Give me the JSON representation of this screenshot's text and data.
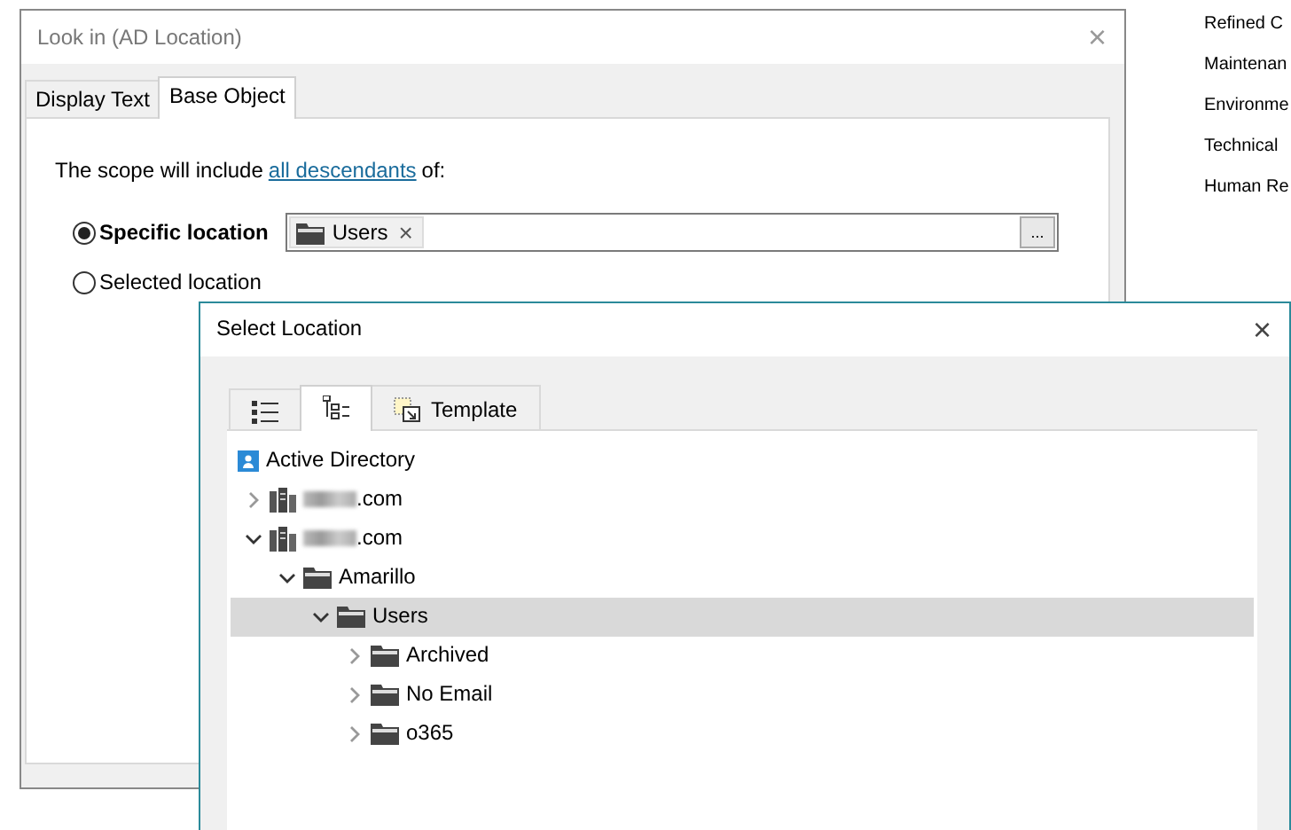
{
  "background_list": [
    "Refined C",
    "Maintenan",
    "Environme",
    "Technical",
    "Human Re"
  ],
  "look_in_dialog": {
    "title": "Look in (AD Location)",
    "close": "×",
    "tabs": [
      {
        "label": "Display Text",
        "selected": false
      },
      {
        "label": "Base Object",
        "selected": true
      }
    ],
    "scope_text": "The scope will include",
    "scope_link": "all descendants",
    "scope_suffix": "of:",
    "options": [
      {
        "label": "Specific location",
        "selected": true
      },
      {
        "label": "Selected location",
        "selected": false
      }
    ],
    "location_token": {
      "label": "Users",
      "remove": "×"
    },
    "browse_button": "..."
  },
  "select_location_dialog": {
    "title": "Select Location",
    "close": "×",
    "tabs": [
      {
        "kind": "list-view",
        "selected": false
      },
      {
        "kind": "tree-view",
        "selected": true
      },
      {
        "kind": "template",
        "label": "Template",
        "selected": false
      }
    ],
    "tree": [
      {
        "kind": "directory",
        "label": "Active Directory",
        "selected": false
      },
      {
        "kind": "domain",
        "label": ".com",
        "redacted": true,
        "expanded": false,
        "selected": false
      },
      {
        "kind": "domain",
        "label": ".com",
        "redacted": true,
        "expanded": true,
        "selected": false,
        "children": [
          {
            "kind": "folder",
            "label": "Amarillo",
            "expanded": true,
            "selected": false,
            "children": [
              {
                "kind": "folder",
                "label": "Users",
                "expanded": true,
                "selected": true,
                "children": [
                  {
                    "kind": "folder",
                    "label": "Archived",
                    "expanded": false,
                    "selected": false
                  },
                  {
                    "kind": "folder",
                    "label": "No Email",
                    "expanded": false,
                    "selected": false
                  },
                  {
                    "kind": "folder",
                    "label": "o365",
                    "expanded": false,
                    "selected": false
                  }
                ]
              }
            ]
          }
        ]
      }
    ]
  }
}
